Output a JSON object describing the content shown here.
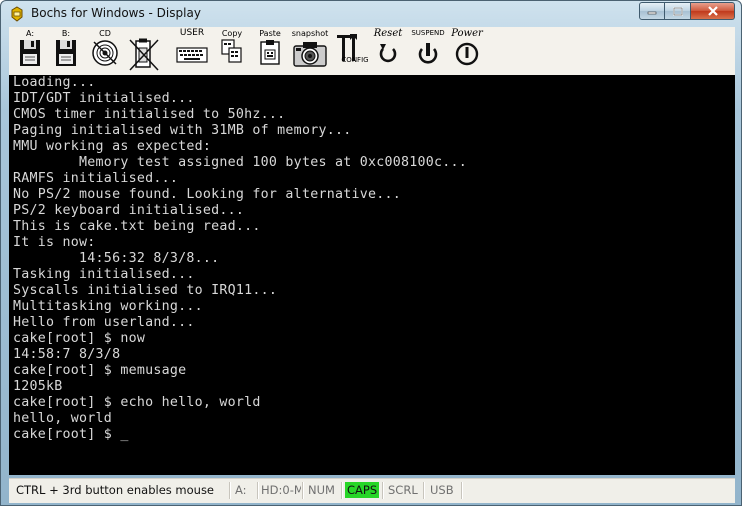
{
  "window": {
    "title": "Bochs for Windows - Display",
    "buttons": {
      "minimize": "minimize",
      "maximize": "maximize",
      "close": "close"
    }
  },
  "toolbar": {
    "items": [
      {
        "id": "floppy-a",
        "label": "A:",
        "icon": "floppy-icon"
      },
      {
        "id": "floppy-b",
        "label": "B:",
        "icon": "floppy-icon"
      },
      {
        "id": "cdrom",
        "label": "CD",
        "icon": "cdrom-icon"
      },
      {
        "id": "usb",
        "label": "",
        "icon": "usb-stick-icon"
      },
      {
        "id": "user",
        "label": "USER",
        "icon": "keyboard-icon"
      },
      {
        "id": "copy",
        "label": "Copy",
        "icon": "copy-icon"
      },
      {
        "id": "paste",
        "label": "Paste",
        "icon": "paste-icon"
      },
      {
        "id": "snapshot",
        "label": "snapshot",
        "icon": "camera-icon"
      },
      {
        "id": "config",
        "label": "CONFIG",
        "icon": "config-icon"
      },
      {
        "id": "reset",
        "label": "Reset",
        "icon": "reset-icon"
      },
      {
        "id": "suspend",
        "label": "SUSPEND",
        "icon": "suspend-icon"
      },
      {
        "id": "power",
        "label": "Power",
        "icon": "power-icon"
      }
    ]
  },
  "console": {
    "lines": [
      "Loading...",
      "IDT/GDT initialised...",
      "CMOS timer initialised to 50hz...",
      "Paging initialised with 31MB of memory...",
      "MMU working as expected:",
      "        Memory test assigned 100 bytes at 0xc008100c...",
      "RAMFS initialised...",
      "No PS/2 mouse found. Looking for alternative...",
      "PS/2 keyboard initialised...",
      "This is cake.txt being read...",
      "It is now:",
      "        14:56:32 8/3/8...",
      "Tasking initialised...",
      "Syscalls initialised to IRQ11...",
      "Multitasking working...",
      "Hello from userland...",
      "cake[root] $ now",
      "14:58:7 8/3/8",
      "cake[root] $ memusage",
      "1205kB",
      "cake[root] $ echo hello, world",
      "hello, world",
      "cake[root] $ _"
    ]
  },
  "statusbar": {
    "hint": "CTRL + 3rd button enables mouse",
    "drive_a": "A:",
    "hd": "HD:0-M",
    "num": "NUM",
    "caps": "CAPS",
    "scrl": "SCRL",
    "usb": "USB",
    "caps_color": "#27d627"
  }
}
